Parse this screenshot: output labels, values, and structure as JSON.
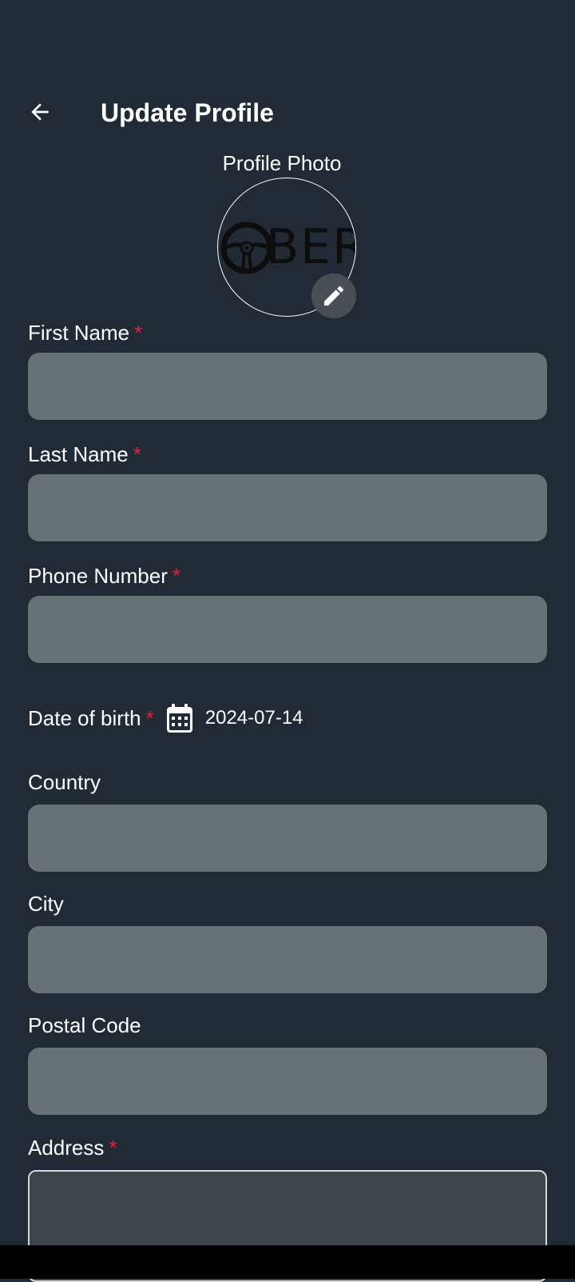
{
  "header": {
    "title": "Update Profile",
    "back_icon": "arrow-left-icon"
  },
  "profile_photo": {
    "label": "Profile Photo",
    "logo_text": "BER",
    "edit_icon": "pencil-icon"
  },
  "fields": {
    "first_name": {
      "label": "First Name",
      "required_mark": "*",
      "value": ""
    },
    "last_name": {
      "label": "Last Name",
      "required_mark": "*",
      "value": ""
    },
    "phone_number": {
      "label": "Phone Number",
      "required_mark": "*",
      "value": ""
    },
    "date_of_birth": {
      "label": "Date of birth",
      "required_mark": "*",
      "value": "2024-07-14",
      "icon": "calendar-icon"
    },
    "country": {
      "label": "Country",
      "value": ""
    },
    "city": {
      "label": "City",
      "value": ""
    },
    "postal_code": {
      "label": "Postal Code",
      "value": ""
    },
    "address": {
      "label": "Address",
      "required_mark": "*",
      "value": ""
    }
  },
  "colors": {
    "background": "#212a35",
    "input_fill": "#687175",
    "required": "#e3223a",
    "edit_button": "#4a4f55",
    "text": "#ffffff"
  }
}
